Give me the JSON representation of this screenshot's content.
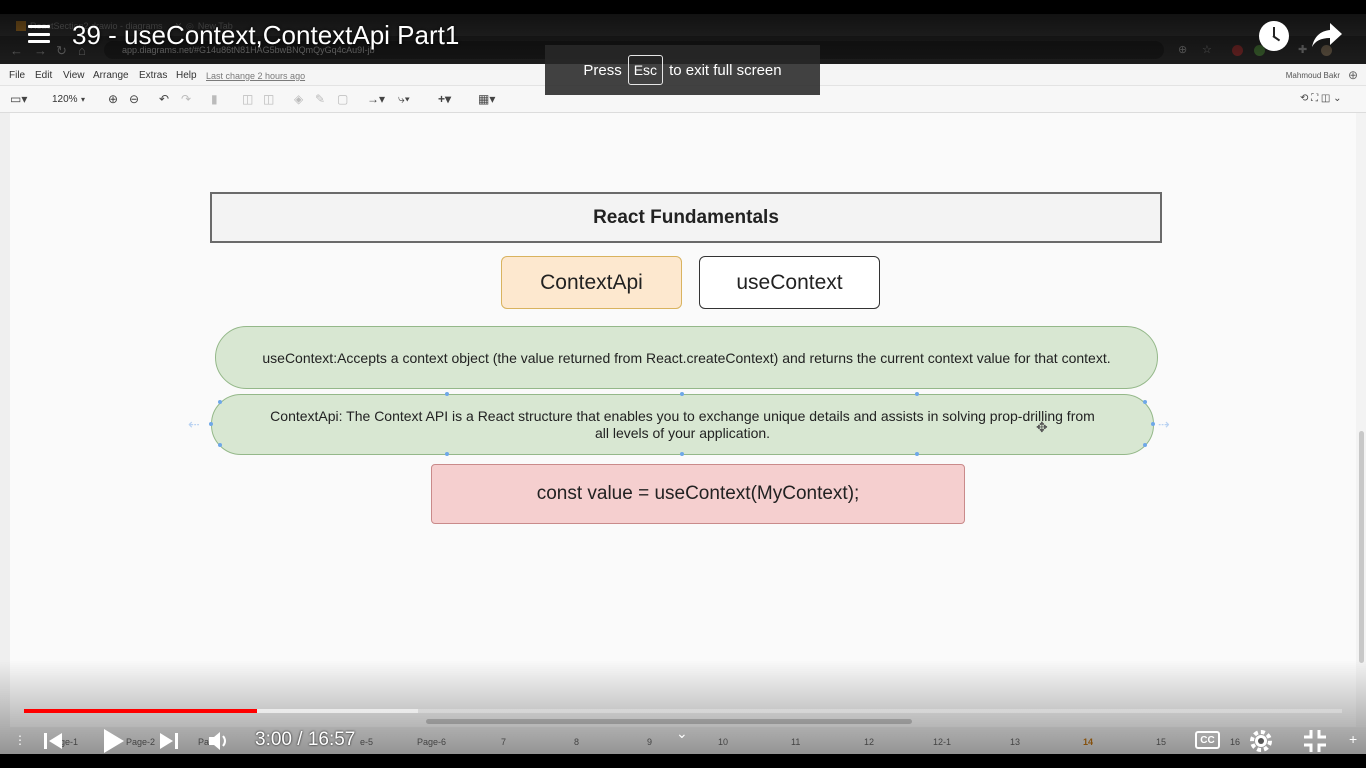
{
  "browser": {
    "tabs": [
      "ReactSection2.drawio - diagrams",
      "New Tab"
    ],
    "url": "app.diagrams.net/#G14u86tN81HAG5bwBNQmQyGq4cAu9I-jb"
  },
  "drawio": {
    "menu": [
      "File",
      "Edit",
      "View",
      "Arrange",
      "Extras",
      "Help"
    ],
    "last_change": "Last change 2 hours ago",
    "user": "Mahmoud Bakr",
    "zoom": "120%",
    "shapes": {
      "title": "React Fundamentals",
      "contextapi": "ContextApi",
      "usecontext": "useContext",
      "def_usecontext": "useContext:Accepts a context object (the value returned from React.createContext) and returns the current context value for that context.",
      "def_contextapi": "ContextApi: The Context API is a React structure that enables you to exchange unique details and assists in solving prop-drilling from all levels of your application.",
      "code": "const value = useContext(MyContext);"
    },
    "pages": [
      "ge-1",
      "Page-2",
      "Pa",
      "e-5",
      "Page-6",
      "7",
      "8",
      "9",
      "10",
      "11",
      "12",
      "12-1",
      "13",
      "14",
      "15",
      "16"
    ],
    "active_page": "14"
  },
  "youtube": {
    "title": "39 - useContext,ContextApi Part1",
    "esc_press": "Press",
    "esc_key": "Esc",
    "esc_suffix": "to exit full screen",
    "time_current": "3:00",
    "time_separator": " / ",
    "time_total": "16:57",
    "progress_played_fraction": 0.177,
    "progress_buffered_fraction": 0.299,
    "cc_label": "CC"
  },
  "colors": {
    "progress": "#ff0000",
    "contextapi_fill": "#fde8cf",
    "definition_fill": "#d8e7d2",
    "code_fill": "#f5cfcf",
    "active_page": "#c97a14"
  }
}
